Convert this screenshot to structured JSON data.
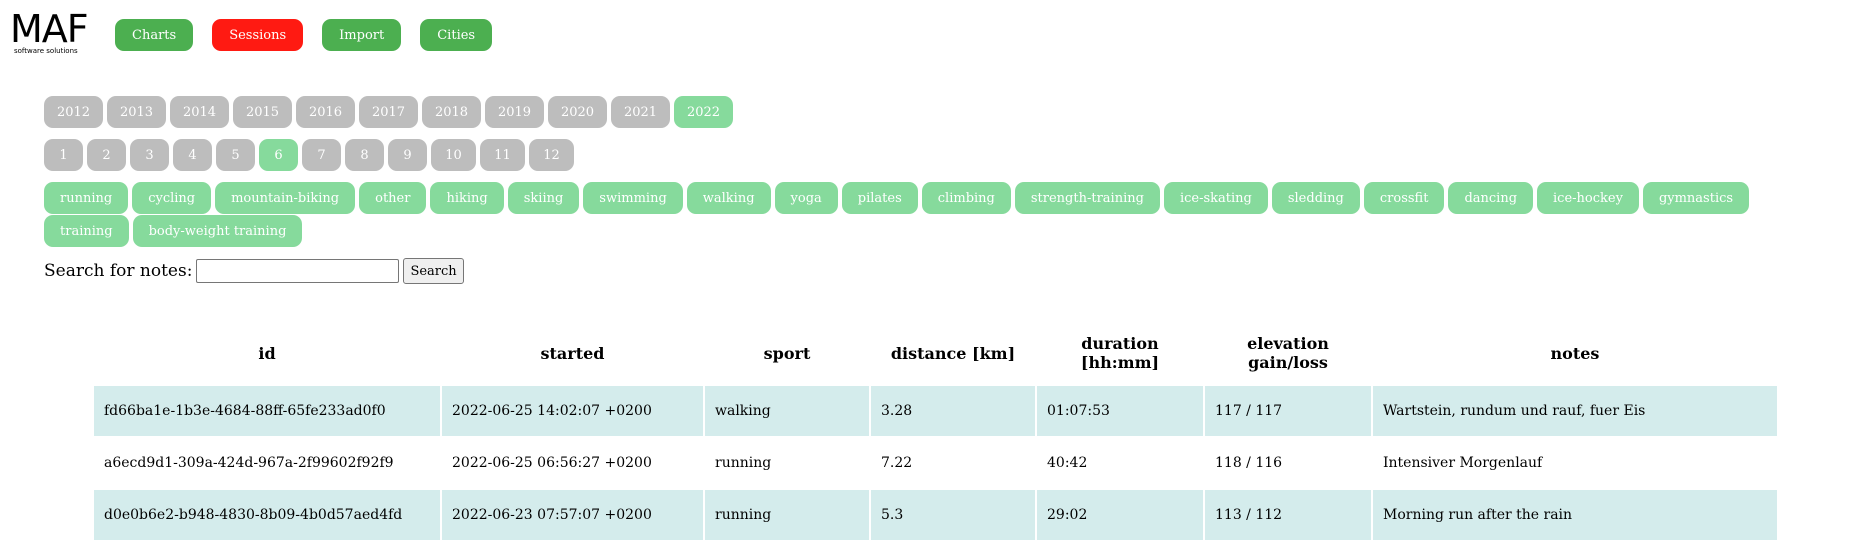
{
  "brand": {
    "logo": "MAF",
    "tagline": "software solutions"
  },
  "colors": {
    "nav_green": "#4caf50",
    "nav_active": "#ff1a12",
    "pill_grey": "#bdbdbd",
    "pill_active": "#86da9c",
    "row_shade": "#d4ecec"
  },
  "nav": [
    {
      "label": "Charts",
      "active": false
    },
    {
      "label": "Sessions",
      "active": true
    },
    {
      "label": "Import",
      "active": false
    },
    {
      "label": "Cities",
      "active": false
    }
  ],
  "years": {
    "items": [
      "2012",
      "2013",
      "2014",
      "2015",
      "2016",
      "2017",
      "2018",
      "2019",
      "2020",
      "2021",
      "2022"
    ],
    "selected": "2022"
  },
  "months": {
    "items": [
      "1",
      "2",
      "3",
      "4",
      "5",
      "6",
      "7",
      "8",
      "9",
      "10",
      "11",
      "12"
    ],
    "selected": "6"
  },
  "sports": [
    "running",
    "cycling",
    "mountain-biking",
    "other",
    "hiking",
    "skiing",
    "swimming",
    "walking",
    "yoga",
    "pilates",
    "climbing",
    "strength-training",
    "ice-skating",
    "sledding",
    "crossfit",
    "dancing",
    "ice-hockey",
    "gymnastics",
    "training",
    "body-weight training"
  ],
  "search": {
    "label": "Search for notes:",
    "value": "",
    "button": "Search"
  },
  "table": {
    "headers": [
      "id",
      "started",
      "sport",
      "distance [km]",
      "duration [hh:mm]",
      "elevation gain/loss",
      "notes"
    ],
    "rows": [
      [
        "fd66ba1e-1b3e-4684-88ff-65fe233ad0f0",
        "2022-06-25 14:02:07 +0200",
        "walking",
        "3.28",
        "01:07:53",
        "117 / 117",
        "Wartstein, rundum und rauf, fuer Eis"
      ],
      [
        "a6ecd9d1-309a-424d-967a-2f99602f92f9",
        "2022-06-25 06:56:27 +0200",
        "running",
        "7.22",
        "40:42",
        "118 / 116",
        "Intensiver Morgenlauf"
      ],
      [
        "d0e0b6e2-b948-4830-8b09-4b0d57aed4fd",
        "2022-06-23 07:57:07 +0200",
        "running",
        "5.3",
        "29:02",
        "113 / 112",
        "Morning run after the rain"
      ]
    ]
  }
}
